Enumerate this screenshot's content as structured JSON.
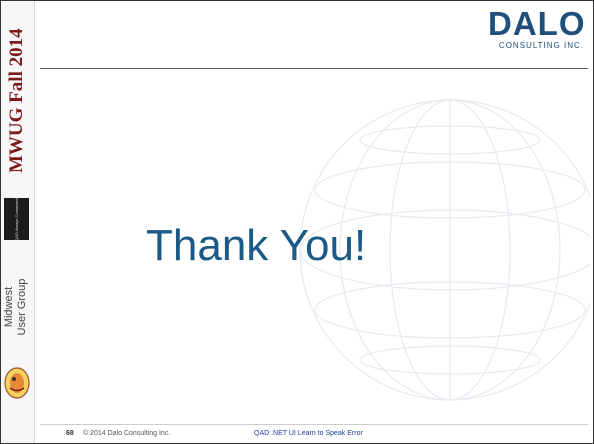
{
  "sidebar": {
    "event_title": "MWUG Fall 2014",
    "qad_badge": "QAD Always Connected",
    "group_name_line1": "Midwest",
    "group_name_line2": "User Group"
  },
  "logo": {
    "wordmark": "DALO",
    "tagline": "CONSULTING INC."
  },
  "main": {
    "title": "Thank You!"
  },
  "footer": {
    "page_number": "68",
    "copyright": "© 2014 Dalo Consulting Inc.",
    "presentation_title": "QAD .NET UI Learn to Speak Error"
  },
  "colors": {
    "title": "#1b5a86",
    "logo": "#1f4f7a",
    "event_title": "#7a1a1a"
  }
}
